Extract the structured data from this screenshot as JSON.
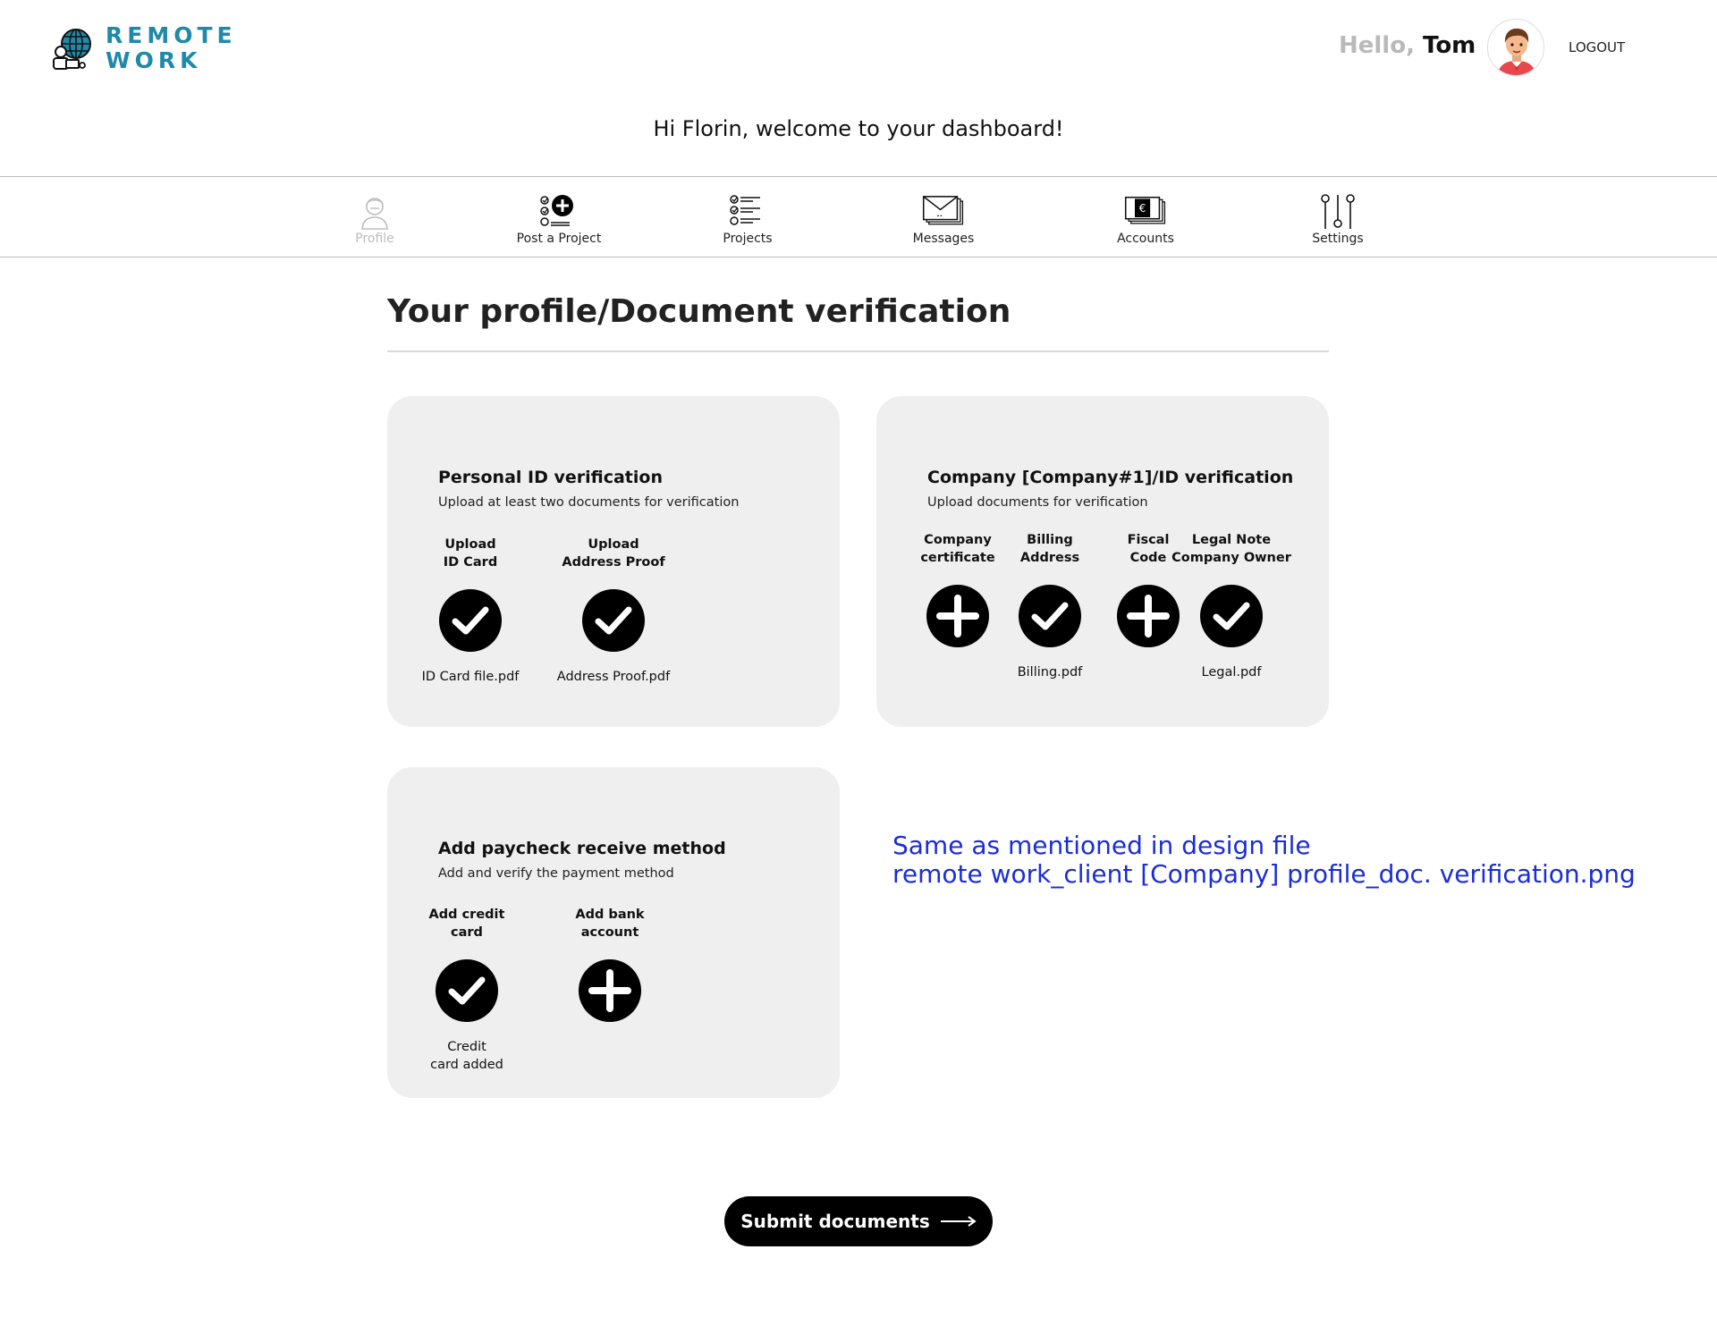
{
  "brand": {
    "line1": "REMOTE",
    "line2": "WORK",
    "color": "#1f8aa8"
  },
  "header": {
    "hello_word": "Hello,",
    "user_name": "Tom",
    "logout_label": "LOGOUT"
  },
  "welcome": "Hi Florin, welcome to your dashboard!",
  "nav": {
    "items": [
      {
        "label": "Profile",
        "icon": "profile-icon",
        "active": false
      },
      {
        "label": "Post a Project",
        "icon": "post-project-icon"
      },
      {
        "label": "Projects",
        "icon": "projects-icon"
      },
      {
        "label": "Messages",
        "icon": "messages-icon"
      },
      {
        "label": "Accounts",
        "icon": "accounts-icon"
      },
      {
        "label": "Settings",
        "icon": "settings-icon"
      }
    ]
  },
  "page_title": "Your profile/Document verification",
  "cards": {
    "personal": {
      "title": "Personal ID verification",
      "subtitle": "Upload at least two documents for verification",
      "docs": [
        {
          "label": "Upload\nID Card",
          "status": "check",
          "file": "ID Card file.pdf"
        },
        {
          "label": "Upload\nAddress Proof",
          "status": "check",
          "file": "Address Proof.pdf"
        }
      ]
    },
    "company": {
      "title": "Company [Company#1]/ID verification",
      "subtitle": "Upload documents for verification",
      "docs": [
        {
          "label": "Company\ncertificate",
          "status": "plus",
          "file": ""
        },
        {
          "label": "Billing\nAddress",
          "status": "check",
          "file": "Billing.pdf"
        },
        {
          "label": "Fiscal\nCode",
          "status": "plus",
          "file": ""
        },
        {
          "label": "Legal Note\nCompany Owner",
          "status": "check",
          "file": "Legal.pdf"
        }
      ]
    },
    "paycheck": {
      "title": "Add paycheck receive method",
      "subtitle": "Add and verify the payment method",
      "docs": [
        {
          "label": "Add credit\ncard",
          "status": "check",
          "file": "Credit\ncard added"
        },
        {
          "label": "Add bank\naccount",
          "status": "plus",
          "file": ""
        }
      ]
    }
  },
  "note": {
    "line1": "Same as mentioned in design file",
    "line2": "remote work_client [Company] profile_doc. verification.png",
    "color": "#1a2dd6"
  },
  "submit_label": "Submit documents"
}
